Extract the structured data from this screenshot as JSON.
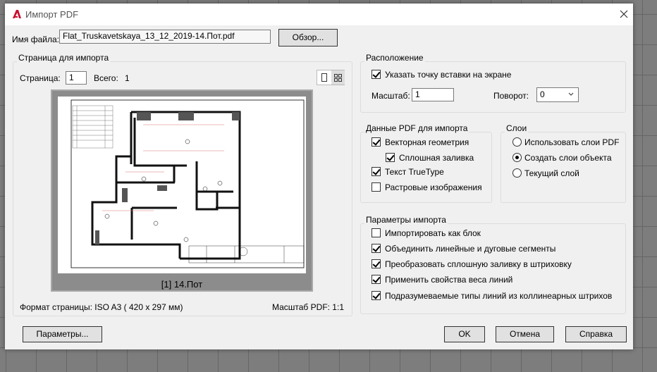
{
  "title": "Импорт PDF",
  "file": {
    "label": "Имя файла:",
    "value": "Flat_Truskavetskaya_13_12_2019-14.Пот.pdf",
    "browse": "Обзор..."
  },
  "page_group": {
    "label": "Страница для импорта",
    "page_label": "Страница:",
    "page_value": "1",
    "total_label": "Всего:",
    "total_value": "1",
    "preview_caption": "[1] 14.Пот",
    "format": "Формат страницы: ISO A3 ( 420 x  297 мм)",
    "pdf_scale": "Масштаб PDF:  1:1"
  },
  "location": {
    "label": "Расположение",
    "specify_onscreen": "Указать точку вставки на экране",
    "specify_checked": true,
    "scale_label": "Масштаб:",
    "scale_value": "1",
    "rotation_label": "Поворот:",
    "rotation_value": "0"
  },
  "pdf_data": {
    "label": "Данные PDF для импорта",
    "items": [
      {
        "label": "Векторная геометрия",
        "checked": true
      },
      {
        "label": "Сплошная заливка",
        "checked": true
      },
      {
        "label": "Текст TrueType",
        "checked": true
      },
      {
        "label": "Растровые изображения",
        "checked": false
      }
    ]
  },
  "layers": {
    "label": "Слои",
    "options": [
      {
        "label": "Использовать слои PDF",
        "selected": false
      },
      {
        "label": "Создать слои объекта",
        "selected": true
      },
      {
        "label": "Текущий слой",
        "selected": false
      }
    ]
  },
  "import_options": {
    "label": "Параметры импорта",
    "items": [
      {
        "label": "Импортировать как блок",
        "checked": false
      },
      {
        "label": "Объединить линейные и дуговые сегменты",
        "checked": true
      },
      {
        "label": "Преобразовать сплошную заливку в штриховку",
        "checked": true
      },
      {
        "label": "Применить свойства веса линий",
        "checked": true
      },
      {
        "label": "Подразумеваемые типы линий из коллинеарных штрихов",
        "checked": true
      }
    ]
  },
  "buttons": {
    "settings": "Параметры...",
    "ok": "OK",
    "cancel": "Отмена",
    "help": "Справка"
  },
  "colors": {
    "accent": "#c8102e"
  }
}
